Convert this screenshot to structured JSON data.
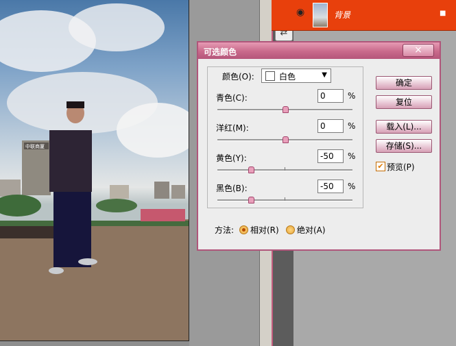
{
  "dialog": {
    "title": "可选颜色",
    "close_label": "×",
    "colors_label": "颜色(O):",
    "colors_value": "白色",
    "rows": [
      {
        "label": "青色(C):",
        "value": "0",
        "slider": 0.5
      },
      {
        "label": "洋红(M):",
        "value": "0",
        "slider": 0.5
      },
      {
        "label": "黄色(Y):",
        "value": "-50",
        "slider": 0.25
      },
      {
        "label": "黑色(B):",
        "value": "-50",
        "slider": 0.25
      }
    ],
    "percent": "%",
    "buttons": {
      "ok": "确定",
      "reset": "复位",
      "load": "载入(L)...",
      "save": "存储(S)..."
    },
    "preview_label": "预览(P)",
    "preview_checked": true,
    "method_label": "方法:",
    "method_relative": "相对(R)",
    "method_absolute": "绝对(A)",
    "method_selected": "relative"
  },
  "layers": {
    "layer_name": "背景"
  },
  "photo": {
    "sign_text": "中联商厦"
  },
  "colors": {
    "dialog_title_accent": "#c8698b",
    "layer_highlight": "#e8400c"
  }
}
